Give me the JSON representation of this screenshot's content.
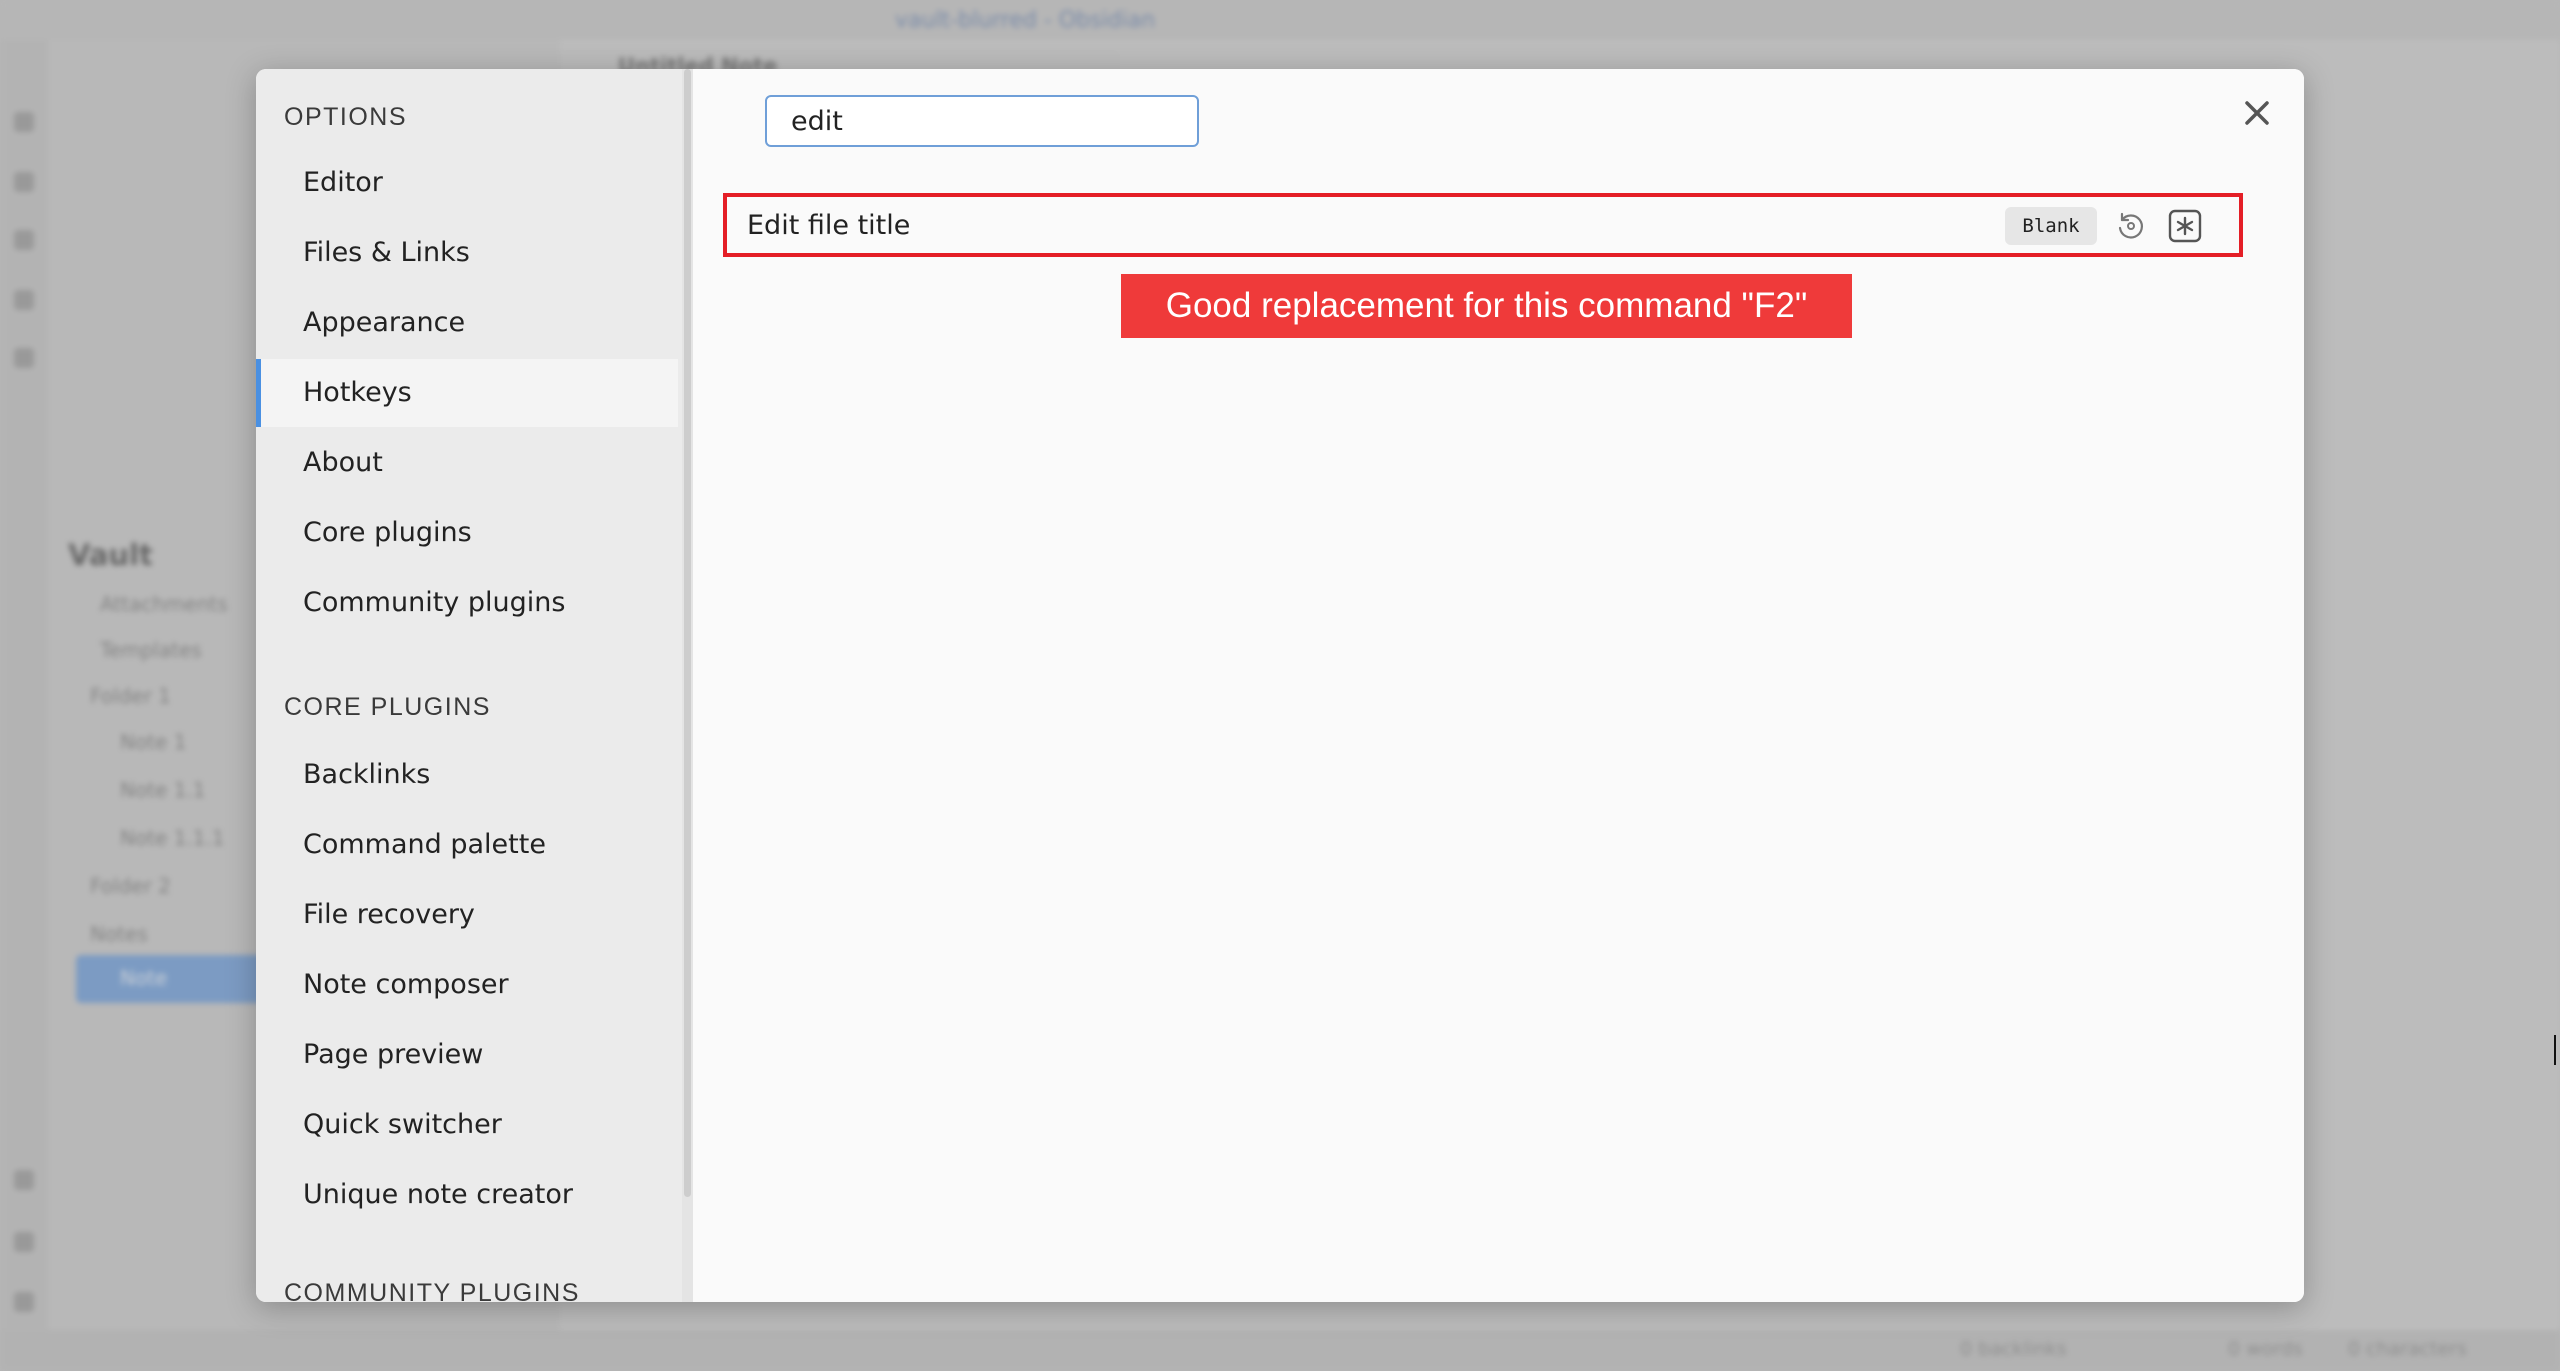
{
  "background_app": {
    "window_title": "vault-blurred - Obsidian",
    "active_tab": "Untitled Note",
    "vault_name": "Vault",
    "tree_items": [
      "Attachments",
      "Templates",
      "Folder 1",
      "Note 1",
      "Note 1.1",
      "Note 1.1.1",
      "Folder 2",
      "Notes",
      "Note"
    ],
    "status_items": [
      "0 backlinks",
      "0 words",
      "0 characters"
    ]
  },
  "settings": {
    "options_heading": "OPTIONS",
    "options_items": [
      {
        "label": "Editor"
      },
      {
        "label": "Files & Links"
      },
      {
        "label": "Appearance"
      },
      {
        "label": "Hotkeys",
        "active": true
      },
      {
        "label": "About"
      },
      {
        "label": "Core plugins"
      },
      {
        "label": "Community plugins"
      }
    ],
    "core_plugins_heading": "CORE PLUGINS",
    "core_plugin_items": [
      {
        "label": "Backlinks"
      },
      {
        "label": "Command palette"
      },
      {
        "label": "File recovery"
      },
      {
        "label": "Note composer"
      },
      {
        "label": "Page preview"
      },
      {
        "label": "Quick switcher"
      },
      {
        "label": "Unique note creator"
      }
    ],
    "community_plugins_heading": "COMMUNITY PLUGINS",
    "search": {
      "value": "edit"
    },
    "hotkey_results": [
      {
        "command": "Edit file title",
        "hotkey": "Blank",
        "restore_icon": "restore-default-icon",
        "add_icon": "add-hotkey-icon"
      }
    ],
    "annotation": "Good replacement for this command \"F2\"",
    "close_icon": "close-icon"
  },
  "colors": {
    "accent": "#4a90e2",
    "highlight_border": "#e41e26",
    "annotation_bg": "#ef3a3a"
  }
}
